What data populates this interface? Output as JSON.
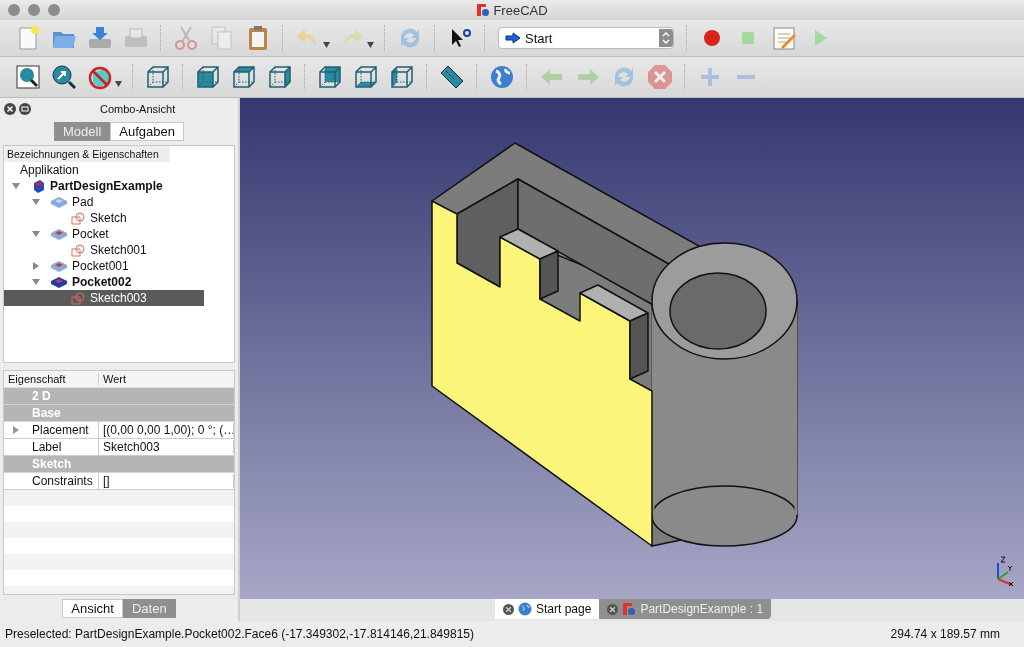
{
  "window": {
    "title": "FreeCAD"
  },
  "toolbars": [
    [
      {
        "kind": "new",
        "disabled": false
      },
      {
        "kind": "open",
        "disabled": false
      },
      {
        "kind": "save",
        "disabled": false
      },
      {
        "kind": "print",
        "disabled": true
      },
      {
        "kind": "sep"
      },
      {
        "kind": "cut",
        "disabled": true
      },
      {
        "kind": "copy",
        "disabled": true
      },
      {
        "kind": "paste",
        "disabled": false
      },
      {
        "kind": "sep"
      },
      {
        "kind": "undo",
        "disabled": true,
        "menu": true
      },
      {
        "kind": "redo",
        "disabled": true,
        "menu": true
      },
      {
        "kind": "sep"
      },
      {
        "kind": "refresh",
        "disabled": true
      },
      {
        "kind": "sep"
      },
      {
        "kind": "whatsthis",
        "disabled": false
      },
      {
        "kind": "sep"
      },
      {
        "kind": "combo",
        "value": "Start"
      },
      {
        "kind": "sep"
      },
      {
        "kind": "record",
        "disabled": false
      },
      {
        "kind": "stop",
        "disabled": true
      },
      {
        "kind": "macro",
        "disabled": false
      },
      {
        "kind": "play",
        "disabled": true
      }
    ],
    [
      {
        "kind": "fitall",
        "disabled": false
      },
      {
        "kind": "fitsel",
        "disabled": false
      },
      {
        "kind": "drawstyle",
        "disabled": false,
        "menu": true
      },
      {
        "kind": "sep"
      },
      {
        "kind": "iso",
        "disabled": false
      },
      {
        "kind": "sep"
      },
      {
        "kind": "front",
        "disabled": false
      },
      {
        "kind": "top",
        "disabled": false
      },
      {
        "kind": "right",
        "disabled": false
      },
      {
        "kind": "sep"
      },
      {
        "kind": "rear",
        "disabled": false
      },
      {
        "kind": "bottom",
        "disabled": false
      },
      {
        "kind": "left",
        "disabled": false
      },
      {
        "kind": "sep"
      },
      {
        "kind": "measure",
        "disabled": false
      },
      {
        "kind": "sep"
      },
      {
        "kind": "globe",
        "disabled": false
      },
      {
        "kind": "sep"
      },
      {
        "kind": "back",
        "disabled": true
      },
      {
        "kind": "forward",
        "disabled": true
      },
      {
        "kind": "reload",
        "disabled": true
      },
      {
        "kind": "halt",
        "disabled": true
      },
      {
        "kind": "sep"
      },
      {
        "kind": "zoomin",
        "disabled": true
      },
      {
        "kind": "zoomout",
        "disabled": true
      }
    ]
  ],
  "combo_view": {
    "title": "Combo-Ansicht",
    "tabs": [
      {
        "label": "Modell",
        "selected": true
      },
      {
        "label": "Aufgaben",
        "selected": false
      }
    ],
    "tree": {
      "header": "Bezeichnungen & Eigenschaften",
      "items": [
        {
          "label": "Applikation",
          "children": [
            {
              "label": "PartDesignExample",
              "kind": "document",
              "bold": true,
              "expanded": true,
              "selected": false,
              "children": [
                {
                  "label": "Pad",
                  "kind": "pad",
                  "bold": false,
                  "expanded": true,
                  "selected": false,
                  "children": [
                    {
                      "label": "Sketch",
                      "kind": "sketch",
                      "bold": false,
                      "selected": false
                    }
                  ]
                },
                {
                  "label": "Pocket",
                  "kind": "pocket",
                  "bold": false,
                  "expanded": true,
                  "selected": false,
                  "children": [
                    {
                      "label": "Sketch001",
                      "kind": "sketch",
                      "bold": false,
                      "selected": false
                    }
                  ]
                },
                {
                  "label": "Pocket001",
                  "kind": "pocket",
                  "bold": false,
                  "expanded": false,
                  "selected": false
                },
                {
                  "label": "Pocket002",
                  "kind": "tip",
                  "bold": true,
                  "expanded": true,
                  "selected": false,
                  "children": [
                    {
                      "label": "Sketch003",
                      "kind": "sketch",
                      "bold": false,
                      "selected": true
                    }
                  ]
                }
              ]
            }
          ]
        }
      ]
    },
    "properties": {
      "columns": [
        "Eigenschaft",
        "Wert"
      ],
      "rows": [
        {
          "kind": "group",
          "name": "2 D"
        },
        {
          "kind": "group",
          "name": "Base"
        },
        {
          "kind": "property",
          "name": "Placement",
          "value": "[(0,00 0,00 1,00); 0 °; (…",
          "expandable": true
        },
        {
          "kind": "property",
          "name": "Label",
          "value": "Sketch003",
          "expandable": false
        },
        {
          "kind": "group",
          "name": "Sketch"
        },
        {
          "kind": "property",
          "name": "Constraints",
          "value": "[]",
          "expandable": false
        }
      ]
    },
    "property_tabs": [
      {
        "label": "Ansicht",
        "selected": false
      },
      {
        "label": "Daten",
        "selected": true
      }
    ]
  },
  "document_tabs": [
    {
      "label": "Start page",
      "kind": "web",
      "selected": false
    },
    {
      "label": "PartDesignExample : 1",
      "kind": "document",
      "selected": true
    }
  ],
  "status_bar": {
    "message": "Preselected: PartDesignExample.Pocket002.Face6 (-17.349302,-17.814146,21.849815)",
    "dimensions": "294.74 x 189.57 mm"
  }
}
